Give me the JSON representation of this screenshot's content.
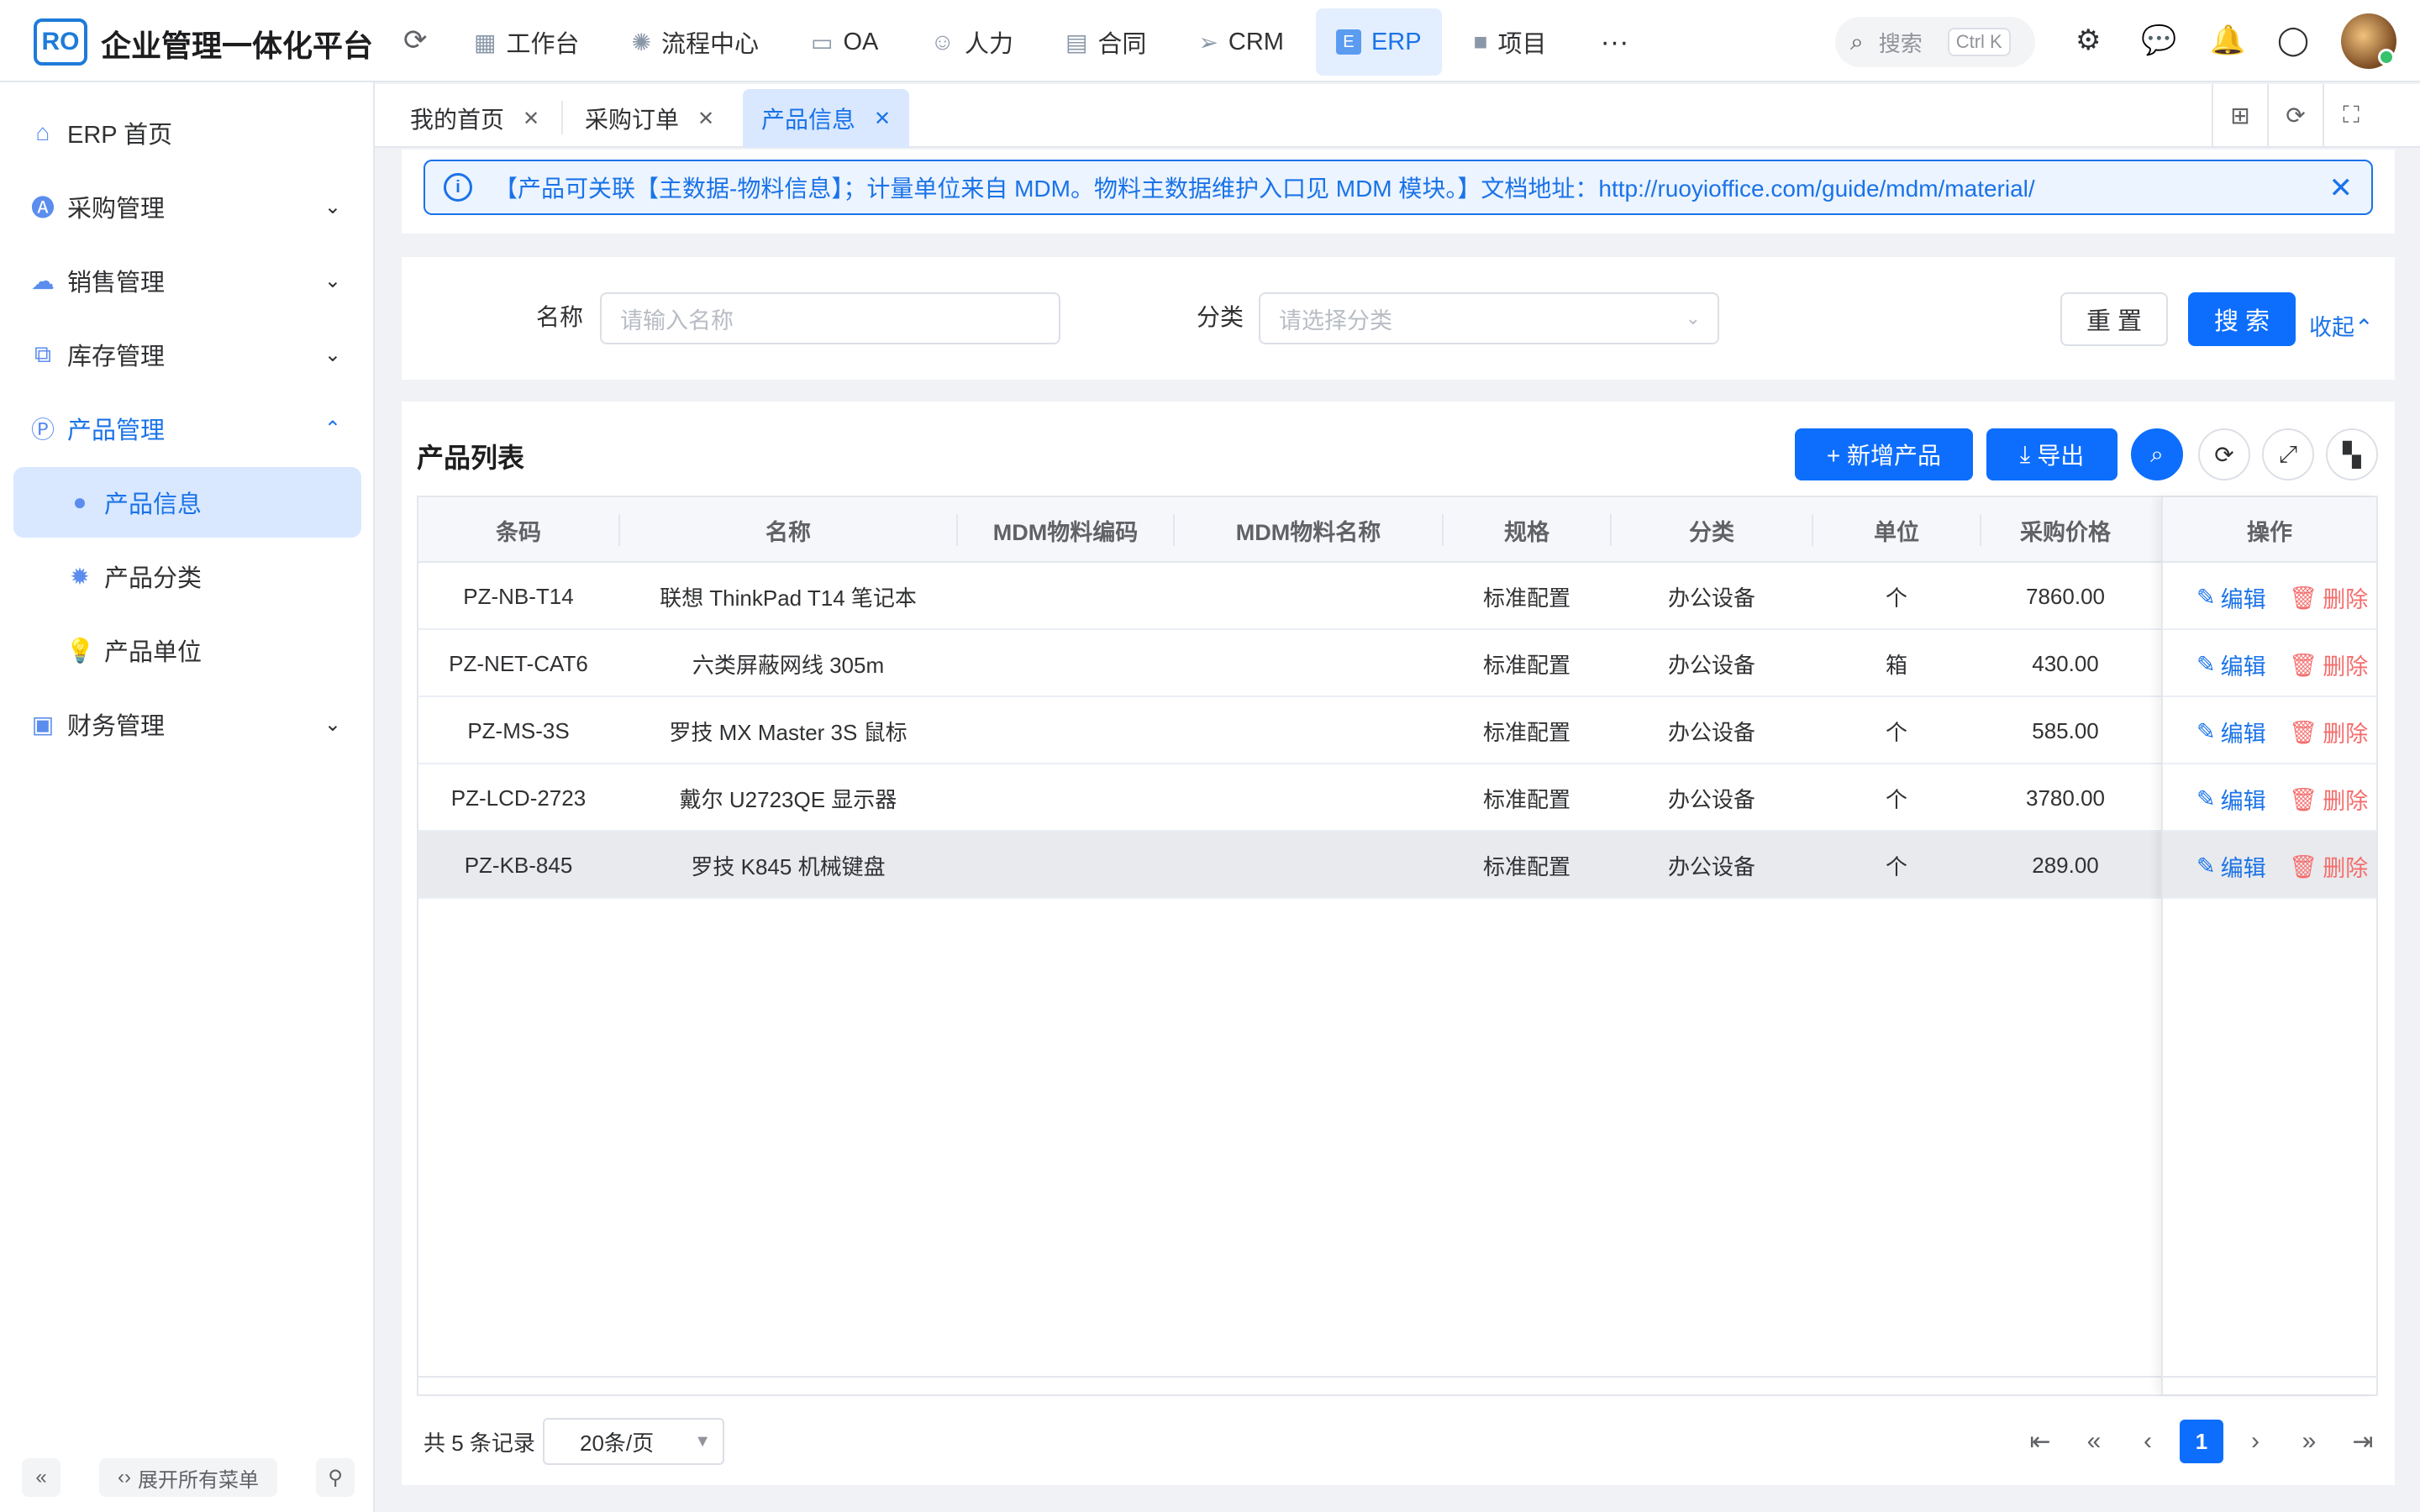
{
  "header": {
    "logo_text": "RO",
    "app_title": "企业管理一体化平台",
    "nav": [
      {
        "label": "工作台",
        "icon": "grid-icon"
      },
      {
        "label": "流程中心",
        "icon": "atom-icon"
      },
      {
        "label": "OA",
        "icon": "monitor-icon"
      },
      {
        "label": "人力",
        "icon": "people-icon"
      },
      {
        "label": "合同",
        "icon": "contract-icon"
      },
      {
        "label": "CRM",
        "icon": "send-icon"
      },
      {
        "label": "ERP",
        "icon": "erp-icon",
        "icon_text": "E",
        "active": true
      },
      {
        "label": "项目",
        "icon": "briefcase-icon"
      }
    ],
    "more": "···",
    "search_placeholder": "搜索",
    "search_shortcut": "Ctrl K"
  },
  "sidebar": {
    "items": [
      {
        "label": "ERP 首页",
        "icon": "home-icon"
      },
      {
        "label": "采购管理",
        "icon": "purchase-icon"
      },
      {
        "label": "销售管理",
        "icon": "sales-icon"
      },
      {
        "label": "库存管理",
        "icon": "stock-icon"
      },
      {
        "label": "产品管理",
        "icon": "product-icon"
      },
      {
        "label": "产品信息",
        "icon": "apple-icon"
      },
      {
        "label": "产品分类",
        "icon": "gear-icon"
      },
      {
        "label": "产品单位",
        "icon": "bulb-icon"
      },
      {
        "label": "财务管理",
        "icon": "finance-icon"
      }
    ],
    "expand_all": "展开所有菜单"
  },
  "tabs": [
    {
      "label": "我的首页"
    },
    {
      "label": "采购订单"
    },
    {
      "label": "产品信息",
      "active": true
    }
  ],
  "alert": {
    "text": "【产品可关联【主数据-物料信息】；计量单位来自 MDM。物料主数据维护入口见 MDM 模块。】文档地址：http://ruoyioffice.com/guide/mdm/material/"
  },
  "search": {
    "name_label": "名称",
    "name_placeholder": "请输入名称",
    "category_label": "分类",
    "category_placeholder": "请选择分类",
    "reset": "重 置",
    "submit": "搜 索",
    "collapse": "收起"
  },
  "list": {
    "title": "产品列表",
    "add_button": "+ 新增产品",
    "export_button": "导出",
    "columns": [
      "条码",
      "名称",
      "MDM物料编码",
      "MDM物料名称",
      "规格",
      "分类",
      "单位",
      "采购价格",
      "操作"
    ],
    "rows": [
      {
        "barcode": "PZ-NB-T14",
        "name": "联想 ThinkPad T14 笔记本",
        "mdm_code": "",
        "mdm_name": "",
        "spec": "标准配置",
        "category": "办公设备",
        "unit": "个",
        "price": "7860.00"
      },
      {
        "barcode": "PZ-NET-CAT6",
        "name": "六类屏蔽网线 305m",
        "mdm_code": "",
        "mdm_name": "",
        "spec": "标准配置",
        "category": "办公设备",
        "unit": "箱",
        "price": "430.00"
      },
      {
        "barcode": "PZ-MS-3S",
        "name": "罗技 MX Master 3S 鼠标",
        "mdm_code": "",
        "mdm_name": "",
        "spec": "标准配置",
        "category": "办公设备",
        "unit": "个",
        "price": "585.00"
      },
      {
        "barcode": "PZ-LCD-2723",
        "name": "戴尔 U2723QE 显示器",
        "mdm_code": "",
        "mdm_name": "",
        "spec": "标准配置",
        "category": "办公设备",
        "unit": "个",
        "price": "3780.00"
      },
      {
        "barcode": "PZ-KB-845",
        "name": "罗技 K845 机械键盘",
        "mdm_code": "",
        "mdm_name": "",
        "spec": "标准配置",
        "category": "办公设备",
        "unit": "个",
        "price": "289.00"
      }
    ],
    "edit_label": "编辑",
    "delete_label": "删除"
  },
  "pagination": {
    "total_text": "共 5 条记录",
    "page_size": "20条/页",
    "current_page": "1"
  },
  "colors": {
    "primary": "#0d6efd",
    "link": "#1a73e8",
    "danger": "#f56c6c"
  }
}
